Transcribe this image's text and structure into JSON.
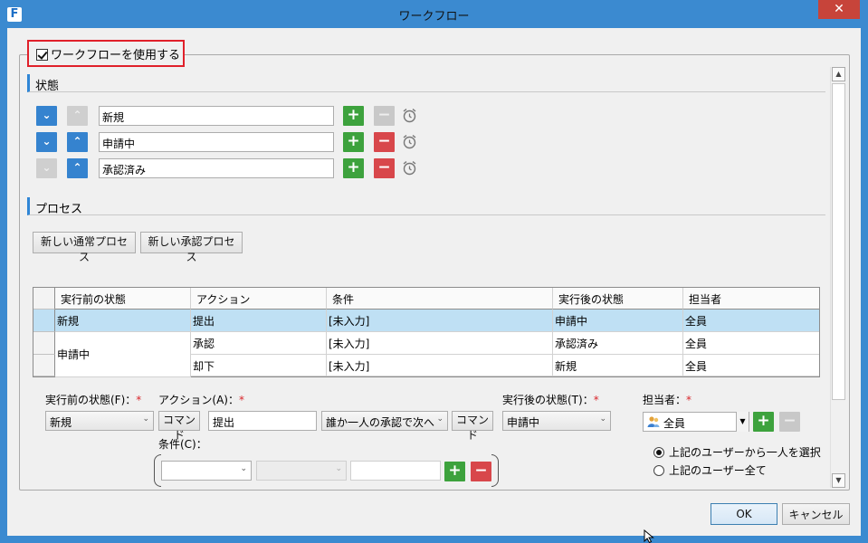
{
  "window": {
    "title": "ワークフロー",
    "app_icon": "F",
    "close_glyph": "✕"
  },
  "workflow_toggle": {
    "label": "ワークフローを使用する",
    "checked": true
  },
  "states_section": {
    "title": "状態",
    "states": [
      {
        "name": "新規"
      },
      {
        "name": "申請中"
      },
      {
        "name": "承認済み"
      }
    ]
  },
  "process_section": {
    "title": "プロセス",
    "new_normal_label": "新しい通常プロセス",
    "new_approval_label": "新しい承認プロセス",
    "columns": [
      "実行前の状態",
      "アクション",
      "条件",
      "実行後の状態",
      "担当者"
    ],
    "rows": [
      {
        "before": "新規",
        "action": "提出",
        "condition": "[未入力]",
        "after": "申請中",
        "assignee": "全員",
        "selected": true
      },
      {
        "before": "申請中",
        "action": "承認",
        "condition": "[未入力]",
        "after": "承認済み",
        "assignee": "全員"
      },
      {
        "before": "",
        "action": "却下",
        "condition": "[未入力]",
        "after": "新規",
        "assignee": "全員"
      }
    ]
  },
  "editor": {
    "before_label": "実行前の状態(F)：",
    "before_value": "新規",
    "action_label": "アクション(A)：",
    "command_label": "コマンド",
    "action_value": "提出",
    "approval_value": "誰か一人の承認で次へ",
    "after_label": "実行後の状態(T)：",
    "after_value": "申請中",
    "assignee_label": "担当者：",
    "assignee_value": "全員",
    "condition_label": "条件(C)：",
    "required_mark": "*",
    "radio_one": "上記のユーザーから一人を選択",
    "radio_all": "上記のユーザー全て"
  },
  "footer": {
    "ok_label": "OK",
    "cancel_label": "キャンセル"
  },
  "glyphs": {
    "plus": "+",
    "minus": "−",
    "down": "⌄",
    "up": "⌃",
    "chev": "⌄"
  },
  "colors": {
    "accent": "#3583cf",
    "add": "#3da23d",
    "remove": "#d8474b",
    "highlight": "#e0202a"
  }
}
